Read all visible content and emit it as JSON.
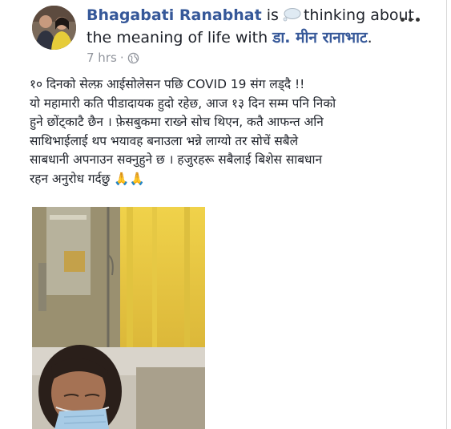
{
  "post": {
    "author": "Bhagabati Ranabhat",
    "is_text": "is",
    "feeling_text": "thinking about",
    "line2_prefix": "the meaning of life with",
    "tagged": "डा. मीन रानाभाट",
    "line2_suffix": ".",
    "time": "7 hrs",
    "dot": "·",
    "body_lines": [
      "१० दिनको सेल्फ़ आईसोलेसन पछि COVID 19 संग लड्दै !!",
      "यो महामारी कति पीडादायक हुदो रहेछ, आज १३ दिन सम्म पनि निको",
      "हुने छोंट्काटै छैन । फ़ेसबुकमा राख्ने सोच थिएन, कतै आफन्त अनि",
      "साथिभाईलाई थप भयावह बनाउला भन्ने लाग्यो तर सोचें सबैले",
      "साबधानी अपनाउन सक्नुहुने छ । हजुरहरू सबैलाई बिशेस साबधान",
      "रहन अनुरोध गर्दछु 🙏🙏"
    ]
  },
  "icons": {
    "thought": "thought-bubble-icon",
    "globe": "globe-icon",
    "more": "more-options-icon"
  },
  "colors": {
    "link": "#365899",
    "meta": "#90949c",
    "text": "#1d2129"
  }
}
